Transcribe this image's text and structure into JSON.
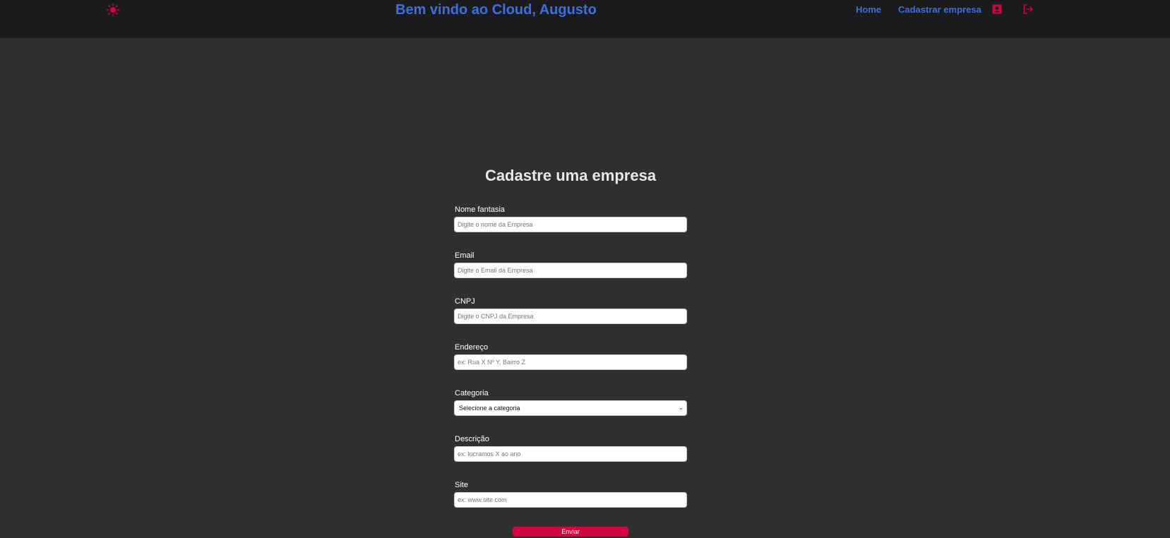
{
  "header": {
    "welcome": "Bem vindo ao Cloud, Augusto",
    "theme_icon": "sun-icon",
    "nav": {
      "home": "Home",
      "register_company": "Cadastrar empresa"
    },
    "profile_icon": "profile-icon",
    "logout_icon": "logout-icon",
    "accent_color": "#3b6fe0",
    "icon_color": "#d1053f"
  },
  "form": {
    "title": "Cadastre uma empresa",
    "fields": {
      "nome": {
        "label": "Nome fantasia",
        "placeholder": "Digite o nome da Empresa"
      },
      "email": {
        "label": "Email",
        "placeholder": "Digite o Email da Empresa"
      },
      "cnpj": {
        "label": "CNPJ",
        "placeholder": "Digite o CNPJ da Empresa"
      },
      "endereco": {
        "label": "Endereço",
        "placeholder": "ex: Rua X Nº Y, Bairro Z"
      },
      "categoria": {
        "label": "Categoria",
        "selected": "Selecione a categoria"
      },
      "descricao": {
        "label": "Descrição",
        "placeholder": "ex: lucramos X ao ano"
      },
      "site": {
        "label": "Site",
        "placeholder": "ex: www.site.com"
      }
    },
    "submit_label": "Enviar"
  }
}
